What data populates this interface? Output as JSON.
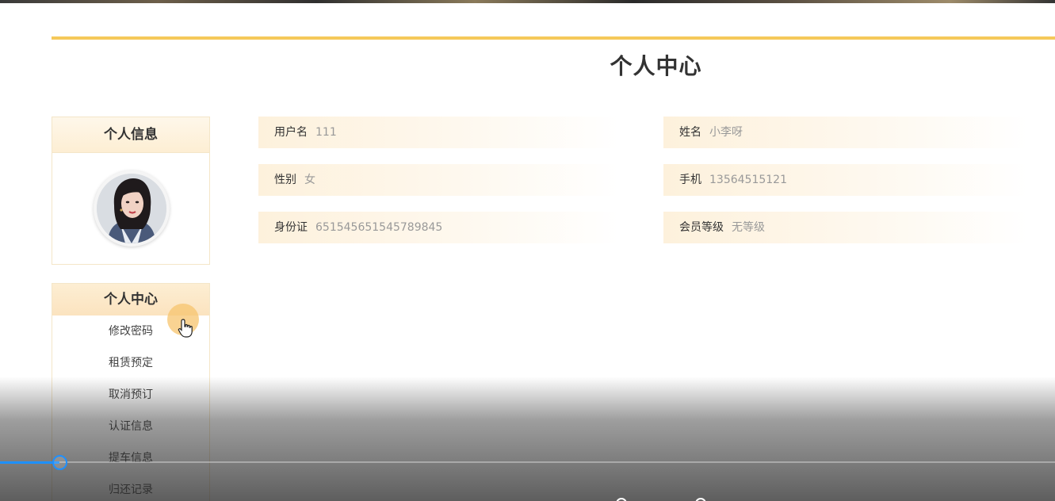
{
  "page": {
    "title": "个人中心"
  },
  "info_card": {
    "title": "个人信息"
  },
  "menu": {
    "title": "个人中心",
    "items": [
      "修改密码",
      "租赁预定",
      "取消预订",
      "认证信息",
      "提车信息",
      "归还记录"
    ]
  },
  "fields": {
    "username": {
      "label": "用户名",
      "value": "111"
    },
    "name": {
      "label": "姓名",
      "value": "小李呀"
    },
    "gender": {
      "label": "性别",
      "value": "女"
    },
    "phone": {
      "label": "手机",
      "value": "13564515121"
    },
    "id_card": {
      "label": "身份证",
      "value": "651545651545789845"
    },
    "member_level": {
      "label": "会员等级",
      "value": "无等级"
    }
  },
  "player": {
    "progress": 0.056
  },
  "colors": {
    "accent": "#f5c95a",
    "progress": "#1e90ff"
  }
}
